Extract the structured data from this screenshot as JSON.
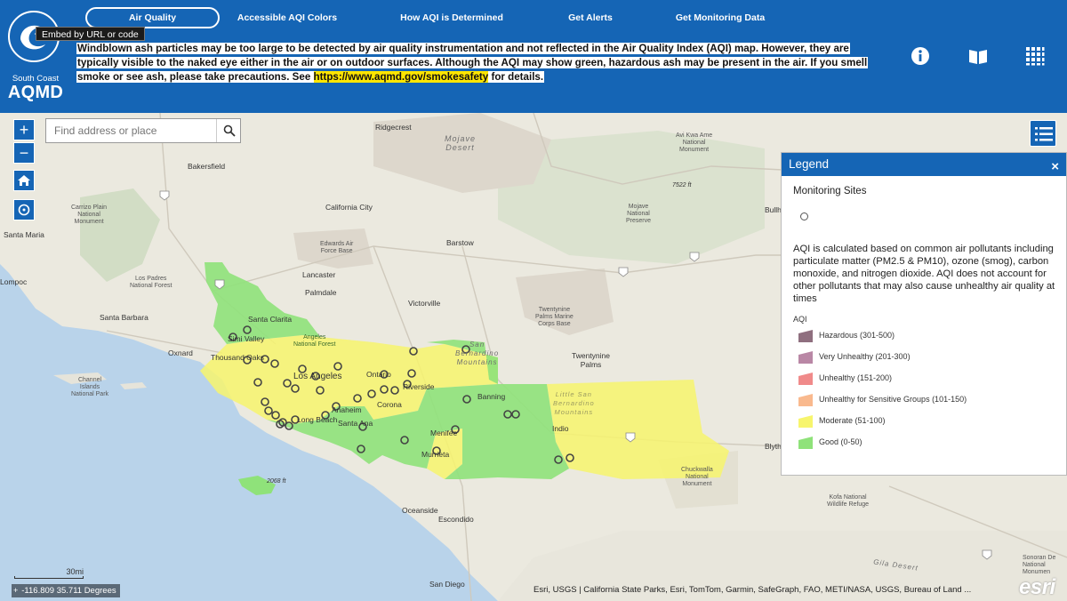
{
  "header": {
    "logo": {
      "line1": "South Coast",
      "line2": "AQMD"
    },
    "embed_tooltip": "Embed by URL or code",
    "nav": [
      {
        "label": "Air Quality",
        "active": true
      },
      {
        "label": "Accessible AQI Colors",
        "active": false
      },
      {
        "label": "How AQI is Determined",
        "active": false
      },
      {
        "label": "Get Alerts",
        "active": false
      },
      {
        "label": "Get Monitoring Data",
        "active": false
      }
    ],
    "notice_text": "Windblown ash particles may be too large to be detected by air quality instrumentation and not reflected in the Air Quality Index (AQI) map. However, they are typically visible to the naked eye either in the air or on outdoor surfaces. Although the AQI may show green, hazardous ash may be present in the air. If you smell smoke or see ash, please take precautions. See",
    "notice_link": "https://www.aqmd.gov/smokesafety",
    "notice_tail": "for details.",
    "icons": [
      "info-icon",
      "book-icon",
      "grid-icon"
    ]
  },
  "map": {
    "search_placeholder": "Find address or place",
    "controls": [
      "zoom-in-icon",
      "zoom-out-icon",
      "home-icon",
      "locate-icon"
    ],
    "place_labels": {
      "ridgecrest": "Ridgecrest",
      "mojave_desert": "Mojave\nDesert",
      "bakersfield": "Bakersfield",
      "california_city": "California City",
      "carrizo": "Carrizo Plain\nNational\nMonument",
      "santa_maria": "Santa Maria",
      "edwards": "Edwards Air\nForce Base",
      "barstow": "Barstow",
      "lancaster": "Lancaster",
      "palmdale": "Palmdale",
      "los_padres": "Los Padres\nNational Forest",
      "lompoc": "Lompoc",
      "victorville": "Victorville",
      "santa_barbara": "Santa Barbara",
      "santa_clarita": "Santa Clarita",
      "simi_valley": "Simi Valley",
      "angeles_nf": "Angeles\nNational Forest",
      "oxnard": "Oxnard",
      "thousand_oaks": "Thousand Oaks",
      "sb_mountains": "San\nBernardino\nMountains",
      "los_angeles": "Los Angeles",
      "ontario": "Ontario",
      "riverside": "Riverside",
      "channel_islands": "Channel\nIslands\nNational Park",
      "anaheim": "Anaheim",
      "corona": "Corona",
      "banning": "Banning",
      "long_beach": "Long Beach",
      "santa_ana": "Santa Ana",
      "menifee": "Menifee",
      "murrieta": "Murrieta",
      "indio": "Indio",
      "little_sb": "Little San\nBernardino\nMountains",
      "twentynine_palms": "Twentynine\nPalms",
      "twentynine_marine": "Twentynine\nPalms Marine\nCorps Base",
      "mojave_preserve": "Mojave\nNational\nPreserve",
      "avi_kwa_ame": "Avi Kwa Ame\nNational\nMonument",
      "elev_7522": "7522 ft",
      "elev_2068": "2068 ft",
      "chuckwalla": "Chuckwalla\nNational\nMonument",
      "oceanside": "Oceanside",
      "escondido": "Escondido",
      "san_diego": "San Diego",
      "kofa": "Kofa National\nWildlife Refuge",
      "gila_desert": "Gila Desert",
      "sonoran": "Sonoran De\nNational\nMonumen",
      "bullh": "Bullh",
      "blyth": "Blyth"
    },
    "scale_label": "30mi",
    "coords": "-116.809 35.711 Degrees",
    "attribution": "Esri, USGS | California State Parks, Esri, TomTom, Garmin, SafeGraph, FAO, METI/NASA, USGS, Bureau of Land ...",
    "esri_logo": "esri"
  },
  "legend": {
    "title": "Legend",
    "close": "×",
    "section_title": "Monitoring Sites",
    "description": "AQI is calculated based on common air pollutants including particulate matter (PM2.5 & PM10), ozone (smog), carbon monoxide, and nitrogen dioxide. AQI does not account for other pollutants that may also cause unhealthy air quality at times",
    "aqi_title": "AQI",
    "items": [
      {
        "label": "Hazardous (301-500)",
        "color": "#8f6f7f"
      },
      {
        "label": "Very Unhealthy (201-300)",
        "color": "#b987a5"
      },
      {
        "label": "Unhealthy (151-200)",
        "color": "#f08a8a"
      },
      {
        "label": "Unhealthy for Sensitive Groups (101-150)",
        "color": "#f9b98e"
      },
      {
        "label": "Moderate (51-100)",
        "color": "#f7f56d"
      },
      {
        "label": "Good (0-50)",
        "color": "#8fe27a"
      }
    ]
  }
}
